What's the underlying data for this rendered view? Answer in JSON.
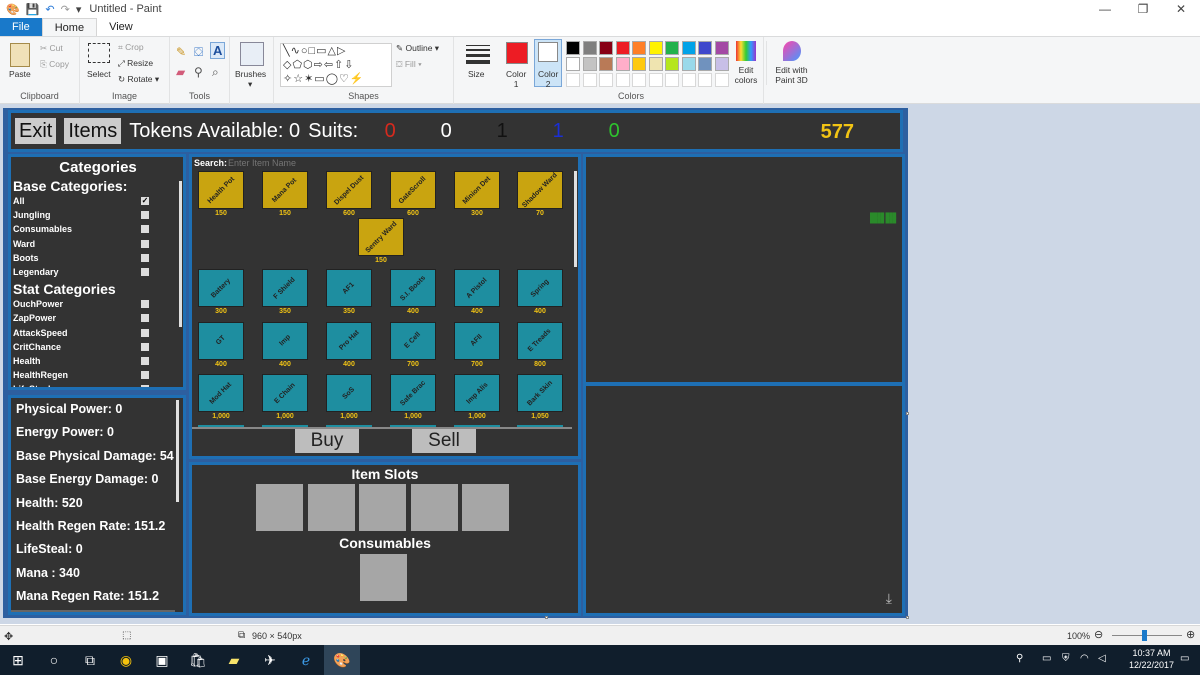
{
  "window": {
    "title": "Untitled - Paint",
    "controls": [
      "—",
      "❐",
      "✕"
    ]
  },
  "menu": {
    "file": "File",
    "home": "Home",
    "view": "View"
  },
  "ribbon": {
    "clipboard": {
      "label": "Clipboard",
      "paste": "Paste",
      "cut": "Cut",
      "copy": "Copy"
    },
    "image": {
      "label": "Image",
      "select": "Select",
      "crop": "Crop",
      "resize": "Resize",
      "rotate": "Rotate"
    },
    "tools": {
      "label": "Tools"
    },
    "brushes": "Brushes",
    "shapes": {
      "label": "Shapes",
      "outline": "Outline",
      "fill": "Fill"
    },
    "size": "Size",
    "color1": "Color\n1",
    "color2": "Color\n2",
    "colors": {
      "label": "Colors",
      "palette_row1": [
        "#000000",
        "#7f7f7f",
        "#880015",
        "#ed1c24",
        "#ff7f27",
        "#fff200",
        "#22b14c",
        "#00a2e8",
        "#3f48cc",
        "#a349a4"
      ],
      "palette_row2": [
        "#ffffff",
        "#c3c3c3",
        "#b97a57",
        "#ffaec9",
        "#ffc90e",
        "#efe4b0",
        "#b5e61d",
        "#99d9ea",
        "#7092be",
        "#c8bfe7"
      ],
      "color1_value": "#ed1c24",
      "color2_value": "#ffffff"
    },
    "edit_colors": "Edit\ncolors",
    "paint3d": "Edit with\nPaint 3D"
  },
  "game": {
    "exit": "Exit",
    "items": "Items",
    "tokens": "Tokens Available: 0",
    "suits_label": "Suits:",
    "suits": [
      {
        "value": "0",
        "color": "#d62a1e"
      },
      {
        "value": "0",
        "color": "#ffffff"
      },
      {
        "value": "1",
        "color": "#111111"
      },
      {
        "value": "1",
        "color": "#1a2fd6"
      },
      {
        "value": "0",
        "color": "#2ec42e"
      }
    ],
    "gold": "577",
    "categories": {
      "title": "Categories",
      "base_title": "Base Categories:",
      "base": [
        {
          "label": "All",
          "checked": "✓"
        },
        {
          "label": "Jungling",
          "checked": ""
        },
        {
          "label": "Consumables",
          "checked": ""
        },
        {
          "label": "Ward",
          "checked": ""
        },
        {
          "label": "Boots",
          "checked": ""
        },
        {
          "label": "Legendary",
          "checked": ""
        }
      ],
      "stat_title": "Stat Categories",
      "stat": [
        {
          "label": "OuchPower",
          "checked": ""
        },
        {
          "label": "ZapPower",
          "checked": ""
        },
        {
          "label": "AttackSpeed",
          "checked": ""
        },
        {
          "label": "CritChance",
          "checked": ""
        },
        {
          "label": "Health",
          "checked": ""
        },
        {
          "label": "HealthRegen",
          "checked": ""
        },
        {
          "label": "LifeSteal",
          "checked": ""
        }
      ]
    },
    "stats": [
      "Physical Power: 0",
      "Energy Power: 0",
      "Base Physical Damage: 54",
      "Base Energy Damage: 0",
      "Health: 520",
      "Health Regen Rate: 151.2",
      "LifeSteal: 0",
      "Mana : 340",
      "Mana Regen Rate: 151.2"
    ],
    "search": {
      "label": "Search:",
      "placeholder": "Enter Item Name"
    },
    "consumable_items": [
      {
        "name": "Health Pot",
        "price": "150"
      },
      {
        "name": "Mana Pot",
        "price": "150"
      },
      {
        "name": "Dispel Dust",
        "price": "600"
      },
      {
        "name": "GateScroll",
        "price": "600"
      },
      {
        "name": "Minion Det",
        "price": "300"
      },
      {
        "name": "Shadow Ward",
        "price": "70"
      },
      {
        "name": "Sentry Ward",
        "price": "150"
      }
    ],
    "shop_items": [
      {
        "name": "Battery",
        "price": "300"
      },
      {
        "name": "F Shield",
        "price": "350"
      },
      {
        "name": "AF1",
        "price": "350"
      },
      {
        "name": "S.I. Boots",
        "price": "400"
      },
      {
        "name": "A Pistol",
        "price": "400"
      },
      {
        "name": "Spring",
        "price": "400"
      },
      {
        "name": "GT",
        "price": "400"
      },
      {
        "name": "Imp",
        "price": "400"
      },
      {
        "name": "Pro Hat",
        "price": "400"
      },
      {
        "name": "E Cell",
        "price": "700"
      },
      {
        "name": "AFII",
        "price": "700"
      },
      {
        "name": "E Treads",
        "price": "800"
      },
      {
        "name": "Mod Hat",
        "price": "1,000"
      },
      {
        "name": "E Chain",
        "price": "1,000"
      },
      {
        "name": "SoS",
        "price": "1,000"
      },
      {
        "name": "Safe Brac",
        "price": "1,000"
      },
      {
        "name": "Imp Alis",
        "price": "1,000"
      },
      {
        "name": "Bark Skin",
        "price": "1,050"
      }
    ],
    "buy": "Buy",
    "sell": "Sell",
    "item_slots_title": "Item Slots",
    "consumables_title": "Consumables",
    "tiny_text": "████ ███\n████ ███",
    "download_icon": "⤓"
  },
  "statusbar": {
    "dimensions": "960 × 540px",
    "zoom": "100%"
  },
  "taskbar": {
    "time": "10:37 AM",
    "date": "12/22/2017"
  }
}
